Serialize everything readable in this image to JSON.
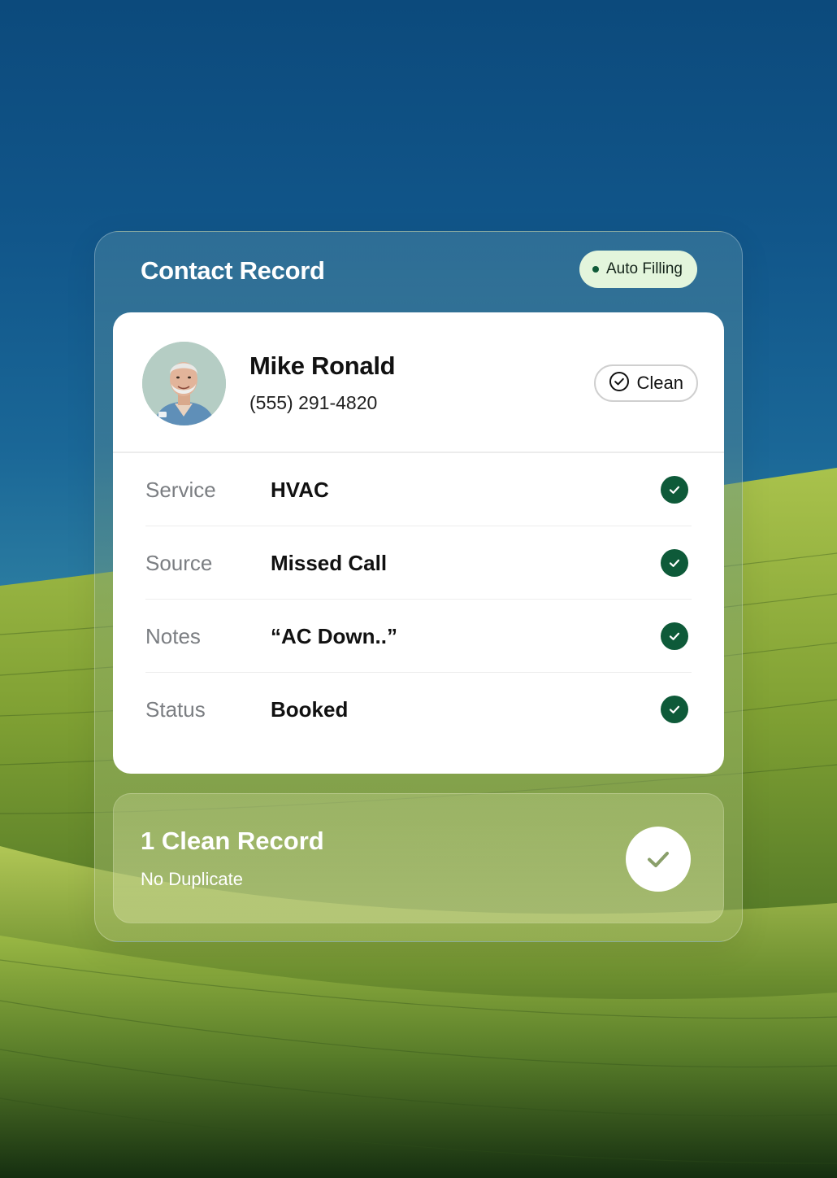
{
  "card": {
    "title": "Contact Record",
    "badge_label": "Auto Filling"
  },
  "contact": {
    "name": "Mike Ronald",
    "phone": "(555) 291-4820",
    "status_pill_label": "Clean"
  },
  "fields": [
    {
      "label": "Service",
      "value": "HVAC"
    },
    {
      "label": "Source",
      "value": "Missed Call"
    },
    {
      "label": "Notes",
      "value": "“AC Down..”"
    },
    {
      "label": "Status",
      "value": "Booked"
    }
  ],
  "summary": {
    "title": "1 Clean Record",
    "subtitle": "No Duplicate"
  },
  "colors": {
    "accent_green": "#0e5a39",
    "badge_bg": "#e3f5dc",
    "sky_blue": "#0c4a7c",
    "field_green": "#8fae3a"
  },
  "icons": {
    "badge": "status-dot-icon",
    "pill": "check-circle-icon",
    "row": "check-icon",
    "summary": "check-icon"
  }
}
